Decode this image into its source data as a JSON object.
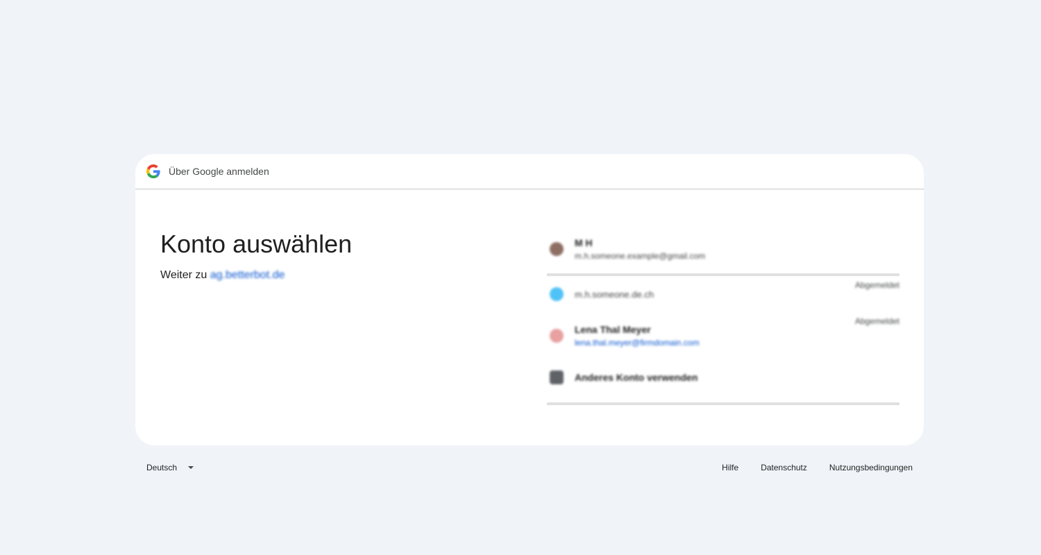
{
  "header": {
    "title": "Über Google anmelden",
    "logo_icon": "google-g-logo"
  },
  "main": {
    "title": "Konto auswählen",
    "subtitle_prefix": "Weiter zu",
    "app_name": "ag.betterbot.de"
  },
  "accounts": [
    {
      "name": "M H",
      "email": "m.h.someone.example@gmail.com",
      "status": "",
      "avatar_color": "#8d6e63"
    },
    {
      "name": "",
      "email": "m.h.someone.de.ch",
      "status": "Abgemeldet",
      "avatar_color": "#4fc3f7"
    },
    {
      "name": "Lena Thal Meyer",
      "email": "lena.thal.meyer@firmdomain.com",
      "status": "Abgemeldet",
      "avatar_color": "#e8a0a0"
    },
    {
      "name": "Anderes Konto verwenden",
      "email": "",
      "status": "",
      "avatar_color": "#5f6368"
    }
  ],
  "footer": {
    "language": "Deutsch",
    "help": "Hilfe",
    "privacy": "Datenschutz",
    "terms": "Nutzungsbedingungen"
  },
  "colors": {
    "background": "#f0f4f9",
    "card": "#ffffff",
    "link": "#0b57d0",
    "divider": "#e0e0e0"
  }
}
